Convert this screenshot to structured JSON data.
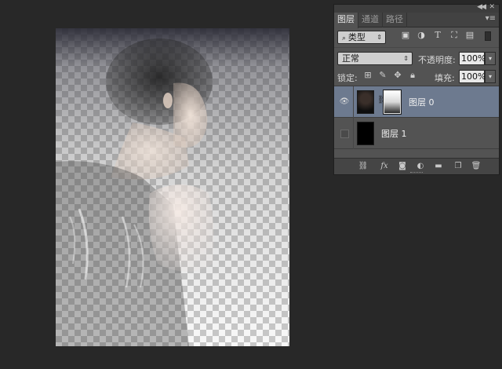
{
  "panel": {
    "tabs": [
      {
        "label": "图层",
        "active": true
      },
      {
        "label": "通道",
        "active": false
      },
      {
        "label": "路径",
        "active": false
      }
    ],
    "filter": {
      "kind_label": "类型",
      "icons": [
        "image-filter-icon",
        "adjustment-filter-icon",
        "type-filter-icon",
        "shape-filter-icon",
        "smart-object-filter-icon"
      ]
    },
    "blend": {
      "mode": "正常",
      "opacity_label": "不透明度:",
      "opacity_value": "100%"
    },
    "lock": {
      "label": "锁定:",
      "fill_label": "填充:",
      "fill_value": "100%",
      "icons": [
        "lock-transparent-icon",
        "lock-pixels-icon",
        "lock-position-icon",
        "lock-all-icon"
      ]
    },
    "layers": [
      {
        "name": "图层 0",
        "visible": true,
        "selected": true,
        "has_mask": true
      },
      {
        "name": "图层 1",
        "visible": false,
        "selected": false,
        "has_mask": false
      }
    ],
    "footer_icons": [
      "link-layers-icon",
      "fx-icon",
      "add-mask-icon",
      "adjustment-layer-icon",
      "new-group-icon",
      "new-layer-icon",
      "delete-layer-icon"
    ]
  },
  "colors": {
    "workspace_bg": "#282828",
    "panel_bg": "#535353",
    "selected_layer": "#6d7a8f"
  }
}
